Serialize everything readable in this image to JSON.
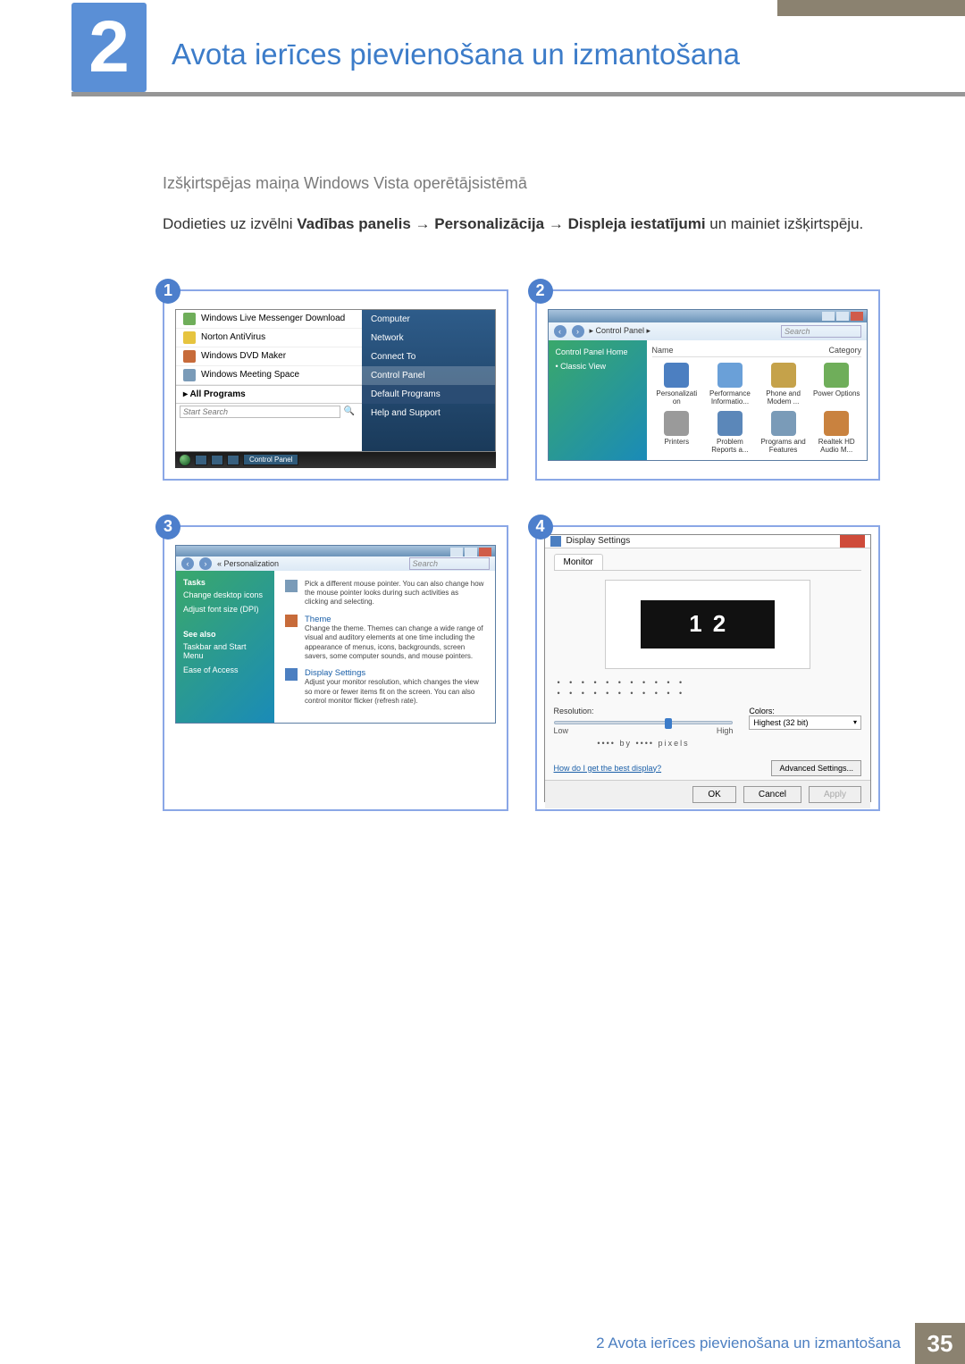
{
  "header": {
    "chapter_number": "2",
    "chapter_title": "Avota ierīces pievienošana un izmantošana"
  },
  "subheading": "Izšķirtspējas maiņa Windows Vista operētājsistēmā",
  "instruction": {
    "pre": "Dodieties uz izvēlni ",
    "b1": "Vadības panelis",
    "arrow": " → ",
    "b2": "Personalizācija",
    "b3": "Displeja iestatījumi",
    "post": " un mainiet izšķirtspēju."
  },
  "steps": {
    "s1": {
      "badge": "1",
      "left_items": [
        "Windows Live Messenger Download",
        "Norton AntiVirus",
        "Windows DVD Maker",
        "Windows Meeting Space"
      ],
      "all_programs": "All Programs",
      "search_placeholder": "Start Search",
      "right_items": [
        "Computer",
        "Network",
        "Connect To",
        "Control Panel",
        "Default Programs",
        "Help and Support"
      ],
      "taskbar_label": "Control Panel"
    },
    "s2": {
      "badge": "2",
      "crumb": "▸ Control Panel ▸",
      "search_placeholder": "Search",
      "side": [
        "Control Panel Home",
        "• Classic View"
      ],
      "columns": [
        "Name",
        "Category"
      ],
      "items": [
        {
          "label": "Personalizati on",
          "color": "#4c7fc1"
        },
        {
          "label": "Performance Informatio...",
          "color": "#6aa0d8"
        },
        {
          "label": "Phone and Modem ...",
          "color": "#c5a24a"
        },
        {
          "label": "Power Options",
          "color": "#6fae5a"
        },
        {
          "label": "Printers",
          "color": "#9a9a9a"
        },
        {
          "label": "Problem Reports a...",
          "color": "#5b87b9"
        },
        {
          "label": "Programs and Features",
          "color": "#7a9bb8"
        },
        {
          "label": "Realtek HD Audio M...",
          "color": "#c9823f"
        }
      ]
    },
    "s3": {
      "badge": "3",
      "crumb": "« Personalization",
      "search_placeholder": "Search",
      "side_tasks_title": "Tasks",
      "side_tasks": [
        "Change desktop icons",
        "Adjust font size (DPI)"
      ],
      "side_seealso_title": "See also",
      "side_seealso": [
        "Taskbar and Start Menu",
        "Ease of Access"
      ],
      "main": [
        {
          "title": "",
          "desc": "Pick a different mouse pointer. You can also change how the mouse pointer looks during such activities as clicking and selecting."
        },
        {
          "title": "Theme",
          "desc": "Change the theme. Themes can change a wide range of visual and auditory elements at one time including the appearance of menus, icons, backgrounds, screen savers, some computer sounds, and mouse pointers."
        },
        {
          "title": "Display Settings",
          "desc": "Adjust your monitor resolution, which changes the view so more or fewer items fit on the screen. You can also control monitor flicker (refresh rate)."
        }
      ]
    },
    "s4": {
      "badge": "4",
      "title": "Display Settings",
      "tab": "Monitor",
      "mon1": "1",
      "mon2": "2",
      "dots": "• • • • • • • • • • •",
      "res_label": "Resolution:",
      "low": "Low",
      "high": "High",
      "pixels": "•••• by •••• pixels",
      "colors_label": "Colors:",
      "colors_value": "Highest (32 bit)",
      "help_link": "How do I get the best display?",
      "advanced": "Advanced Settings...",
      "ok": "OK",
      "cancel": "Cancel",
      "apply": "Apply"
    }
  },
  "footer": {
    "text": "2 Avota ierīces pievienošana un izmantošana",
    "page": "35"
  }
}
